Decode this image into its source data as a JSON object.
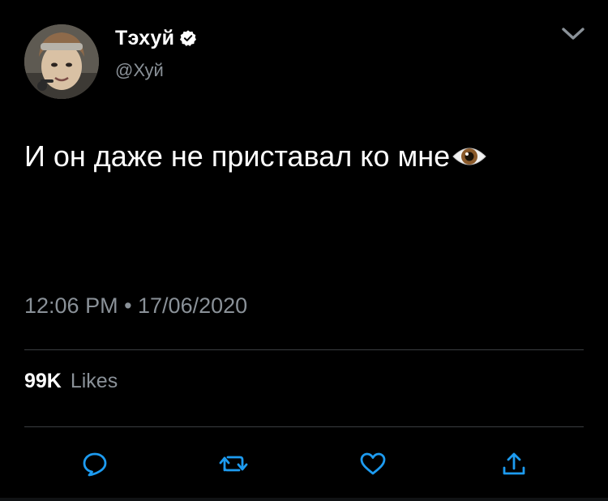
{
  "tweet": {
    "author": {
      "display_name": "Тэхуй",
      "handle": "@Хуй",
      "verified": true,
      "avatar_icon": "user-avatar"
    },
    "text": "И он даже не приставал ко мне",
    "emoji": "eye-emoji",
    "timestamp": "12:06 PM • 17/06/2020",
    "likes": {
      "count": "99K",
      "label": "Likes"
    }
  },
  "icons": {
    "menu": "chevron-down-icon",
    "reply": "reply-icon",
    "retweet": "retweet-icon",
    "like": "heart-icon",
    "share": "share-icon",
    "verified": "verified-badge-icon"
  },
  "colors": {
    "background": "#000000",
    "text_primary": "#ffffff",
    "text_secondary": "#8a9198",
    "divider": "#3a3d41",
    "icon": "#1d9bf0",
    "chevron": "#8a9198"
  }
}
